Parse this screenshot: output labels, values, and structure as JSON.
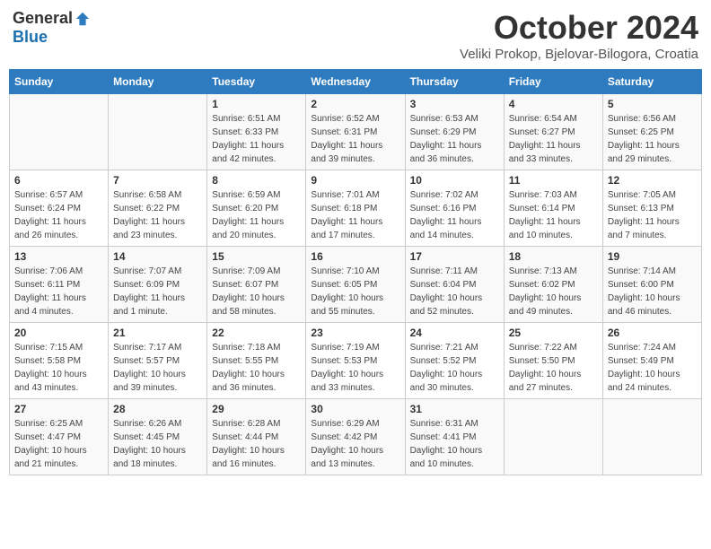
{
  "header": {
    "logo_general": "General",
    "logo_blue": "Blue",
    "month": "October 2024",
    "location": "Veliki Prokop, Bjelovar-Bilogora, Croatia"
  },
  "weekdays": [
    "Sunday",
    "Monday",
    "Tuesday",
    "Wednesday",
    "Thursday",
    "Friday",
    "Saturday"
  ],
  "weeks": [
    [
      {
        "day": "",
        "info": ""
      },
      {
        "day": "",
        "info": ""
      },
      {
        "day": "1",
        "info": "Sunrise: 6:51 AM\nSunset: 6:33 PM\nDaylight: 11 hours and 42 minutes."
      },
      {
        "day": "2",
        "info": "Sunrise: 6:52 AM\nSunset: 6:31 PM\nDaylight: 11 hours and 39 minutes."
      },
      {
        "day": "3",
        "info": "Sunrise: 6:53 AM\nSunset: 6:29 PM\nDaylight: 11 hours and 36 minutes."
      },
      {
        "day": "4",
        "info": "Sunrise: 6:54 AM\nSunset: 6:27 PM\nDaylight: 11 hours and 33 minutes."
      },
      {
        "day": "5",
        "info": "Sunrise: 6:56 AM\nSunset: 6:25 PM\nDaylight: 11 hours and 29 minutes."
      }
    ],
    [
      {
        "day": "6",
        "info": "Sunrise: 6:57 AM\nSunset: 6:24 PM\nDaylight: 11 hours and 26 minutes."
      },
      {
        "day": "7",
        "info": "Sunrise: 6:58 AM\nSunset: 6:22 PM\nDaylight: 11 hours and 23 minutes."
      },
      {
        "day": "8",
        "info": "Sunrise: 6:59 AM\nSunset: 6:20 PM\nDaylight: 11 hours and 20 minutes."
      },
      {
        "day": "9",
        "info": "Sunrise: 7:01 AM\nSunset: 6:18 PM\nDaylight: 11 hours and 17 minutes."
      },
      {
        "day": "10",
        "info": "Sunrise: 7:02 AM\nSunset: 6:16 PM\nDaylight: 11 hours and 14 minutes."
      },
      {
        "day": "11",
        "info": "Sunrise: 7:03 AM\nSunset: 6:14 PM\nDaylight: 11 hours and 10 minutes."
      },
      {
        "day": "12",
        "info": "Sunrise: 7:05 AM\nSunset: 6:13 PM\nDaylight: 11 hours and 7 minutes."
      }
    ],
    [
      {
        "day": "13",
        "info": "Sunrise: 7:06 AM\nSunset: 6:11 PM\nDaylight: 11 hours and 4 minutes."
      },
      {
        "day": "14",
        "info": "Sunrise: 7:07 AM\nSunset: 6:09 PM\nDaylight: 11 hours and 1 minute."
      },
      {
        "day": "15",
        "info": "Sunrise: 7:09 AM\nSunset: 6:07 PM\nDaylight: 10 hours and 58 minutes."
      },
      {
        "day": "16",
        "info": "Sunrise: 7:10 AM\nSunset: 6:05 PM\nDaylight: 10 hours and 55 minutes."
      },
      {
        "day": "17",
        "info": "Sunrise: 7:11 AM\nSunset: 6:04 PM\nDaylight: 10 hours and 52 minutes."
      },
      {
        "day": "18",
        "info": "Sunrise: 7:13 AM\nSunset: 6:02 PM\nDaylight: 10 hours and 49 minutes."
      },
      {
        "day": "19",
        "info": "Sunrise: 7:14 AM\nSunset: 6:00 PM\nDaylight: 10 hours and 46 minutes."
      }
    ],
    [
      {
        "day": "20",
        "info": "Sunrise: 7:15 AM\nSunset: 5:58 PM\nDaylight: 10 hours and 43 minutes."
      },
      {
        "day": "21",
        "info": "Sunrise: 7:17 AM\nSunset: 5:57 PM\nDaylight: 10 hours and 39 minutes."
      },
      {
        "day": "22",
        "info": "Sunrise: 7:18 AM\nSunset: 5:55 PM\nDaylight: 10 hours and 36 minutes."
      },
      {
        "day": "23",
        "info": "Sunrise: 7:19 AM\nSunset: 5:53 PM\nDaylight: 10 hours and 33 minutes."
      },
      {
        "day": "24",
        "info": "Sunrise: 7:21 AM\nSunset: 5:52 PM\nDaylight: 10 hours and 30 minutes."
      },
      {
        "day": "25",
        "info": "Sunrise: 7:22 AM\nSunset: 5:50 PM\nDaylight: 10 hours and 27 minutes."
      },
      {
        "day": "26",
        "info": "Sunrise: 7:24 AM\nSunset: 5:49 PM\nDaylight: 10 hours and 24 minutes."
      }
    ],
    [
      {
        "day": "27",
        "info": "Sunrise: 6:25 AM\nSunset: 4:47 PM\nDaylight: 10 hours and 21 minutes."
      },
      {
        "day": "28",
        "info": "Sunrise: 6:26 AM\nSunset: 4:45 PM\nDaylight: 10 hours and 18 minutes."
      },
      {
        "day": "29",
        "info": "Sunrise: 6:28 AM\nSunset: 4:44 PM\nDaylight: 10 hours and 16 minutes."
      },
      {
        "day": "30",
        "info": "Sunrise: 6:29 AM\nSunset: 4:42 PM\nDaylight: 10 hours and 13 minutes."
      },
      {
        "day": "31",
        "info": "Sunrise: 6:31 AM\nSunset: 4:41 PM\nDaylight: 10 hours and 10 minutes."
      },
      {
        "day": "",
        "info": ""
      },
      {
        "day": "",
        "info": ""
      }
    ]
  ]
}
